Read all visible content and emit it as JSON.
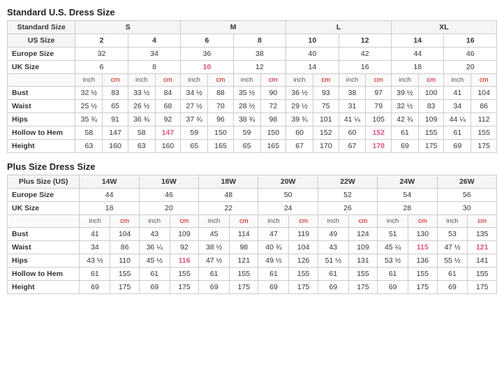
{
  "standard_title": "Standard U.S. Dress Size",
  "plus_title": "Plus Size Dress Size",
  "standard_table": {
    "size_groups": [
      "S",
      "M",
      "L",
      "XL"
    ],
    "size_group_spans": [
      2,
      2,
      2,
      2
    ],
    "rows": {
      "us_size": {
        "label": "US Size",
        "values": [
          "2",
          "4",
          "6",
          "8",
          "10",
          "12",
          "14",
          "16"
        ],
        "highlights": [
          false,
          false,
          false,
          false,
          false,
          false,
          false,
          false
        ]
      },
      "europe_size": {
        "label": "Europe Size",
        "values": [
          "32",
          "34",
          "36",
          "38",
          "40",
          "42",
          "44",
          "46"
        ]
      },
      "uk_size": {
        "label": "UK Size",
        "values": [
          "6",
          "8",
          "10",
          "12",
          "14",
          "16",
          "18",
          "20"
        ],
        "highlights": [
          false,
          false,
          true,
          false,
          false,
          false,
          false,
          false
        ]
      },
      "bust": {
        "label": "Bust",
        "values": [
          {
            "inch": "32 ½",
            "cm": "83"
          },
          {
            "inch": "33 ½",
            "cm": "84"
          },
          {
            "inch": "34 ½",
            "cm": "88"
          },
          {
            "inch": "35 ½",
            "cm": "90"
          },
          {
            "inch": "36 ½",
            "cm": "93"
          },
          {
            "inch": "38",
            "cm": "97"
          },
          {
            "inch": "39 ½",
            "cm": "100"
          },
          {
            "inch": "41",
            "cm": "104"
          }
        ]
      },
      "waist": {
        "label": "Waist",
        "values": [
          {
            "inch": "25 ½",
            "cm": "65"
          },
          {
            "inch": "26 ½",
            "cm": "68"
          },
          {
            "inch": "27 ½",
            "cm": "70"
          },
          {
            "inch": "28 ½",
            "cm": "72"
          },
          {
            "inch": "29 ½",
            "cm": "75"
          },
          {
            "inch": "31",
            "cm": "79"
          },
          {
            "inch": "32 ½",
            "cm": "83"
          },
          {
            "inch": "34",
            "cm": "86"
          }
        ]
      },
      "hips": {
        "label": "Hips",
        "values": [
          {
            "inch": "35 ¾",
            "cm": "91"
          },
          {
            "inch": "36 ¾",
            "cm": "92"
          },
          {
            "inch": "37 ¾",
            "cm": "96"
          },
          {
            "inch": "38 ¾",
            "cm": "98"
          },
          {
            "inch": "39 ¾",
            "cm": "101"
          },
          {
            "inch": "41 ¼",
            "cm": "105"
          },
          {
            "inch": "42 ¾",
            "cm": "109"
          },
          {
            "inch": "44 ¼",
            "cm": "112"
          }
        ]
      },
      "hollow_to_hem": {
        "label": "Hollow to Hem",
        "values": [
          {
            "inch": "58",
            "cm": "147"
          },
          {
            "inch": "58",
            "cm": "147"
          },
          {
            "inch": "59",
            "cm": "150"
          },
          {
            "inch": "59",
            "cm": "150"
          },
          {
            "inch": "60",
            "cm": "152"
          },
          {
            "inch": "60",
            "cm": "152"
          },
          {
            "inch": "61",
            "cm": "155"
          },
          {
            "inch": "61",
            "cm": "155"
          }
        ],
        "highlights_cm": [
          false,
          true,
          false,
          false,
          false,
          true,
          false,
          false
        ]
      },
      "height": {
        "label": "Height",
        "values": [
          {
            "inch": "63",
            "cm": "160"
          },
          {
            "inch": "63",
            "cm": "160"
          },
          {
            "inch": "65",
            "cm": "165"
          },
          {
            "inch": "65",
            "cm": "165"
          },
          {
            "inch": "67",
            "cm": "170"
          },
          {
            "inch": "67",
            "cm": "170"
          },
          {
            "inch": "69",
            "cm": "175"
          },
          {
            "inch": "69",
            "cm": "175"
          }
        ]
      }
    }
  },
  "plus_table": {
    "sizes": [
      "14W",
      "16W",
      "18W",
      "20W",
      "22W",
      "24W",
      "26W"
    ],
    "rows": {
      "europe_size": {
        "label": "Europe Size",
        "values": [
          "44",
          "46",
          "48",
          "50",
          "52",
          "54",
          "56"
        ]
      },
      "uk_size": {
        "label": "UK Size",
        "values": [
          "18",
          "20",
          "22",
          "24",
          "26",
          "28",
          "30"
        ]
      },
      "bust": {
        "label": "Bust",
        "values": [
          {
            "inch": "41",
            "cm": "104"
          },
          {
            "inch": "43",
            "cm": "109"
          },
          {
            "inch": "45",
            "cm": "114"
          },
          {
            "inch": "47",
            "cm": "119"
          },
          {
            "inch": "49",
            "cm": "124"
          },
          {
            "inch": "51",
            "cm": "130"
          },
          {
            "inch": "53",
            "cm": "135"
          }
        ]
      },
      "waist": {
        "label": "Waist",
        "values": [
          {
            "inch": "34",
            "cm": "86"
          },
          {
            "inch": "36 ¼",
            "cm": "92"
          },
          {
            "inch": "38 ½",
            "cm": "98"
          },
          {
            "inch": "40 ¾",
            "cm": "104"
          },
          {
            "inch": "43",
            "cm": "109"
          },
          {
            "inch": "45 ¼",
            "cm": "115"
          },
          {
            "inch": "47 ½",
            "cm": "121"
          }
        ],
        "highlights_cm": [
          false,
          false,
          false,
          false,
          false,
          true,
          true
        ]
      },
      "hips": {
        "label": "Hips",
        "values": [
          {
            "inch": "43 ½",
            "cm": "110"
          },
          {
            "inch": "45 ½",
            "cm": "116"
          },
          {
            "inch": "47 ½",
            "cm": "121"
          },
          {
            "inch": "49 ½",
            "cm": "126"
          },
          {
            "inch": "51 ½",
            "cm": "131"
          },
          {
            "inch": "53 ½",
            "cm": "136"
          },
          {
            "inch": "55 ½",
            "cm": "141"
          }
        ],
        "highlights_cm": [
          false,
          true,
          false,
          false,
          false,
          false,
          false
        ]
      },
      "hollow_to_hem": {
        "label": "Hollow to Hem",
        "values": [
          {
            "inch": "61",
            "cm": "155"
          },
          {
            "inch": "61",
            "cm": "155"
          },
          {
            "inch": "61",
            "cm": "155"
          },
          {
            "inch": "61",
            "cm": "155"
          },
          {
            "inch": "61",
            "cm": "155"
          },
          {
            "inch": "61",
            "cm": "155"
          },
          {
            "inch": "61",
            "cm": "155"
          }
        ]
      },
      "height": {
        "label": "Height",
        "values": [
          {
            "inch": "69",
            "cm": "175"
          },
          {
            "inch": "69",
            "cm": "175"
          },
          {
            "inch": "69",
            "cm": "175"
          },
          {
            "inch": "69",
            "cm": "175"
          },
          {
            "inch": "69",
            "cm": "175"
          },
          {
            "inch": "69",
            "cm": "175"
          },
          {
            "inch": "69",
            "cm": "175"
          }
        ]
      }
    }
  }
}
